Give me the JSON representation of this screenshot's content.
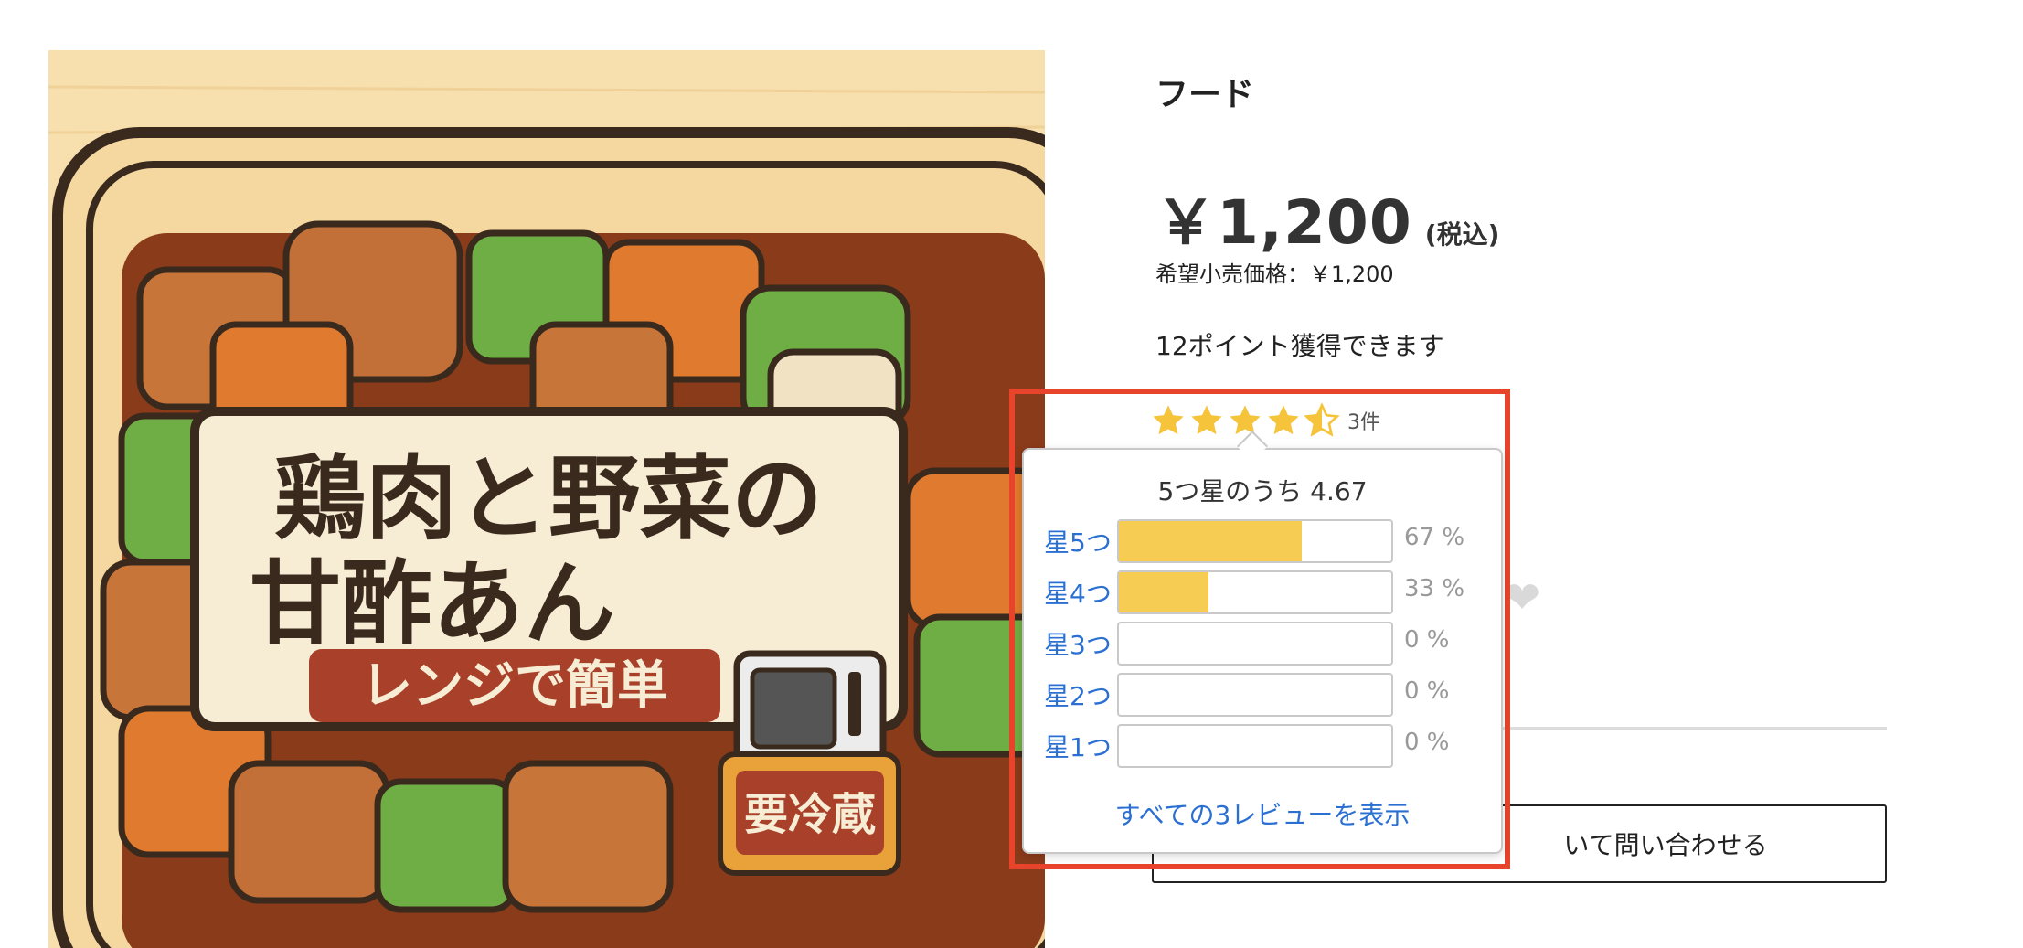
{
  "product": {
    "image_text": {
      "title_line1": "鶏肉と野菜の",
      "title_line2": "甘酢あん",
      "subtitle": "レンジで簡単",
      "badge": "要冷蔵"
    },
    "category": "フード",
    "price": "￥1,200",
    "tax_note": "(税込)",
    "msrp": "希望小売価格：￥1,200",
    "points": "12ポイント獲得できます",
    "inquiry_button": "いて問い合わせる"
  },
  "rating": {
    "stars_value": 4.67,
    "count": "3件",
    "popover": {
      "title": "5つ星のうち 4.67",
      "rows": [
        {
          "label": "星5つ",
          "percent": 67,
          "percent_text": "67 %"
        },
        {
          "label": "星4つ",
          "percent": 33,
          "percent_text": "33 %"
        },
        {
          "label": "星3つ",
          "percent": 0,
          "percent_text": "0 %"
        },
        {
          "label": "星2つ",
          "percent": 0,
          "percent_text": "0 %"
        },
        {
          "label": "星1つ",
          "percent": 0,
          "percent_text": "0 %"
        }
      ],
      "see_all": "すべての3レビューを表示"
    }
  },
  "colors": {
    "star": "#f6c43b",
    "bar_fill": "#f6cd52",
    "link": "#2a6fd1",
    "highlight": "#e8432b"
  }
}
